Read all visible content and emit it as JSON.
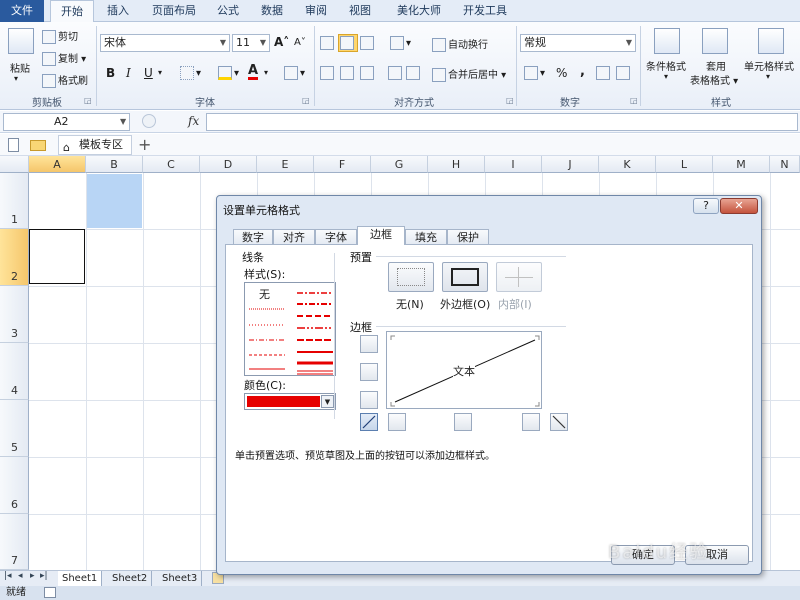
{
  "ribbon_tabs": [
    "文件",
    "开始",
    "插入",
    "页面布局",
    "公式",
    "数据",
    "审阅",
    "视图",
    "美化大师",
    "开发工具"
  ],
  "clipboard": {
    "paste": "粘贴",
    "cut": "剪切",
    "copy": "复制",
    "format_painter": "格式刷",
    "group": "剪贴板"
  },
  "font": {
    "name": "宋体",
    "size": "11",
    "group": "字体",
    "bold": "B",
    "italic": "I",
    "underline": "U",
    "grow": "A",
    "shrink": "A",
    "font_color": "A"
  },
  "alignment": {
    "wrap_text": "自动换行",
    "merge_center": "合并后居中",
    "group": "对齐方式"
  },
  "number": {
    "format": "常规",
    "percent": "%",
    "comma": ",",
    "group": "数字"
  },
  "styles": {
    "conditional": "条件格式",
    "table_line1": "套用",
    "table_line2": "表格格式",
    "cell_styles": "单元格样式",
    "group": "样式"
  },
  "formula_bar": {
    "name_box": "A2",
    "fx": "fx"
  },
  "nav": {
    "template_tab": "模板专区",
    "add": "+"
  },
  "columns": [
    "A",
    "B",
    "C",
    "D",
    "E",
    "F",
    "G",
    "H",
    "I",
    "J",
    "K",
    "L",
    "M",
    "N"
  ],
  "rows": [
    "1",
    "2",
    "3",
    "4",
    "5",
    "6",
    "7"
  ],
  "sheets": [
    "Sheet1",
    "Sheet2",
    "Sheet3"
  ],
  "status": "就绪",
  "dialog": {
    "title": "设置单元格格式",
    "help": "?",
    "close": "✕",
    "tabs": [
      "数字",
      "对齐",
      "字体",
      "边框",
      "填充",
      "保护"
    ],
    "line_section": "线条",
    "style_label": "样式(S):",
    "style_none": "无",
    "color_label": "颜色(C):",
    "color_value": "#e60000",
    "preset_section": "预置",
    "preset_none": "无(N)",
    "preset_outline": "外边框(O)",
    "preset_inside": "内部(I)",
    "border_section": "边框",
    "preview_text": "文本",
    "hint": "单击预置选项、预览草图及上面的按钮可以添加边框样式。",
    "ok": "确定",
    "cancel": "取消"
  },
  "watermark": "Baidu经验"
}
